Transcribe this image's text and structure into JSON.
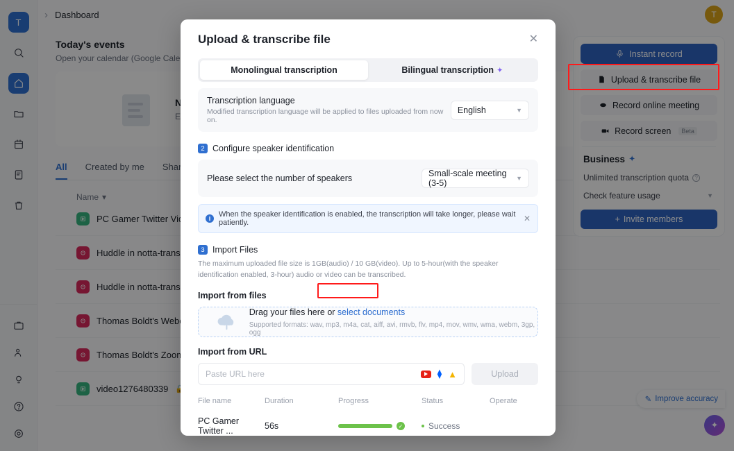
{
  "rail": {
    "workspace_initial": "T",
    "items": [
      {
        "name": "search-icon",
        "label": "Search"
      },
      {
        "name": "home-icon",
        "label": "Home",
        "active": true
      },
      {
        "name": "folder-icon",
        "label": "Files"
      },
      {
        "name": "calendar-icon",
        "label": "Calendar"
      },
      {
        "name": "notes-icon",
        "label": "Notes"
      },
      {
        "name": "trash-icon",
        "label": "Trash"
      }
    ],
    "bottom_items": [
      {
        "name": "briefcase-icon",
        "label": "Business"
      },
      {
        "name": "person-add-icon",
        "label": "Invite"
      },
      {
        "name": "bulb-icon",
        "label": "Tips"
      },
      {
        "name": "help-icon",
        "label": "Help"
      },
      {
        "name": "gear-icon",
        "label": "Settings"
      }
    ]
  },
  "topbar": {
    "breadcrumb": "Dashboard",
    "avatar_initial": "T"
  },
  "events": {
    "title": "Today's events",
    "subtitle": "Open your calendar (Google Calendar",
    "empty_title": "No ev",
    "empty_sub": "Events"
  },
  "list": {
    "tabs": [
      {
        "label": "All",
        "active": true
      },
      {
        "label": "Created by me",
        "active": false
      },
      {
        "label": "Share",
        "active": false
      }
    ],
    "column_header": "Name",
    "rows": [
      {
        "name": "PC Gamer Twitter Video Demo",
        "icon": "video-file-icon",
        "color": "green",
        "locked": true
      },
      {
        "name": "Huddle in notta-transcription-arti",
        "icon": "slack-huddle-icon",
        "color": "red",
        "locked": false
      },
      {
        "name": "Huddle in notta-transcription-arti",
        "icon": "slack-huddle-icon",
        "color": "red",
        "locked": false
      },
      {
        "name": "Thomas Boldt's Webex Meeting",
        "icon": "webex-icon",
        "color": "red",
        "locked": false
      },
      {
        "name": "Thomas Boldt's Zoom Meeting",
        "icon": "zoom-icon",
        "color": "red",
        "locked": true
      },
      {
        "name": "video1276480339",
        "icon": "video-file-icon",
        "color": "green",
        "locked": true
      }
    ]
  },
  "right_panel": {
    "actions": [
      {
        "label": "Instant record",
        "icon": "microphone-icon",
        "primary": true,
        "beta": ""
      },
      {
        "label": "Upload & transcribe file",
        "icon": "upload-file-icon",
        "primary": false,
        "beta": ""
      },
      {
        "label": "Record online meeting",
        "icon": "meeting-icon",
        "primary": false,
        "beta": ""
      },
      {
        "label": "Record screen",
        "icon": "camera-icon",
        "primary": false,
        "beta": "Beta"
      }
    ],
    "business_title": "Business",
    "quota": "Unlimited transcription quota",
    "feature_usage": "Check feature usage",
    "invite_label": "Invite members"
  },
  "floating": {
    "improve_label": "Improve accuracy",
    "improve_icon": "magic-wand-icon",
    "fab_icon": "sparkle-icon"
  },
  "modal": {
    "title": "Upload & transcribe file",
    "close_icon": "close-icon",
    "tabs": [
      {
        "label": "Monolingual transcription",
        "active": true,
        "badge": ""
      },
      {
        "label": "Bilingual transcription",
        "active": false,
        "badge": "sparkle-icon"
      }
    ],
    "language": {
      "label": "Transcription language",
      "hint": "Modified transcription language will be applied to files uploaded from now on.",
      "value": "English"
    },
    "step2": {
      "number": "2",
      "title": "Configure speaker identification",
      "row_label": "Please select the number of speakers",
      "value": "Small-scale meeting (3-5)"
    },
    "tip": {
      "text": "When the speaker identification is enabled, the transcription will take longer, please wait patiently.",
      "icon": "info-icon",
      "close_icon": "close-icon"
    },
    "step3": {
      "number": "3",
      "title": "Import Files",
      "description": "The maximum uploaded file size is 1GB(audio) / 10 GB(video). Up to 5-hour(with the speaker identification enabled, 3-hour) audio or video can be transcribed."
    },
    "import_files_label": "Import from files",
    "drop": {
      "icon": "cloud-upload-icon",
      "text": "Drag your files here or",
      "link": "select documents",
      "formats": "Supported formats: wav, mp3, m4a, cat, aiff, avi, rmvb, flv, mp4, mov, wmv, wma, webm, 3gp, ogg"
    },
    "import_url_label": "Import from URL",
    "url_placeholder": "Paste URL here",
    "url_value": "",
    "url_services": [
      "youtube-icon",
      "dropbox-icon",
      "google-drive-icon"
    ],
    "upload_button": "Upload",
    "table": {
      "columns": [
        "File name",
        "Duration",
        "Progress",
        "Status",
        "Operate"
      ],
      "rows": [
        {
          "file_name": "PC Gamer Twitter ...",
          "duration": "56s",
          "progress": 100,
          "status": "Success",
          "operate": ""
        }
      ]
    }
  },
  "colors": {
    "accent": "#2f6fd0",
    "primary_button": "#2f63c0",
    "success": "#6cc24a",
    "highlight": "#ff1a1a",
    "red_icon": "#d7295c",
    "green_icon": "#36b37e"
  }
}
